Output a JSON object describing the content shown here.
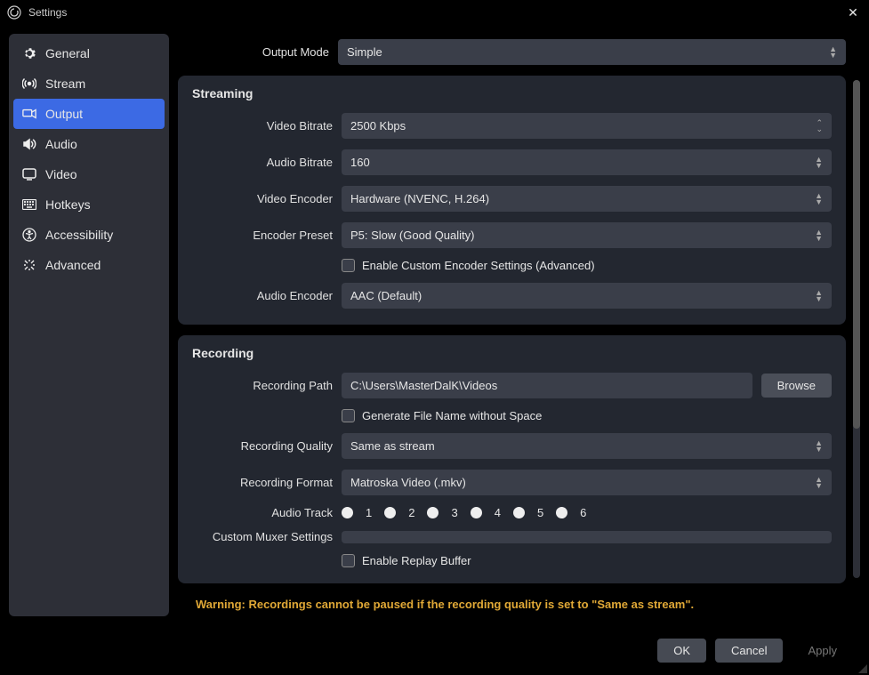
{
  "window": {
    "title": "Settings"
  },
  "sidebar": {
    "items": [
      {
        "label": "General"
      },
      {
        "label": "Stream"
      },
      {
        "label": "Output"
      },
      {
        "label": "Audio"
      },
      {
        "label": "Video"
      },
      {
        "label": "Hotkeys"
      },
      {
        "label": "Accessibility"
      },
      {
        "label": "Advanced"
      }
    ]
  },
  "outputMode": {
    "label": "Output Mode",
    "value": "Simple"
  },
  "streaming": {
    "title": "Streaming",
    "videoBitrate": {
      "label": "Video Bitrate",
      "value": "2500 Kbps"
    },
    "audioBitrate": {
      "label": "Audio Bitrate",
      "value": "160"
    },
    "videoEncoder": {
      "label": "Video Encoder",
      "value": "Hardware (NVENC, H.264)"
    },
    "encoderPreset": {
      "label": "Encoder Preset",
      "value": "P5: Slow (Good Quality)"
    },
    "enableCustom": {
      "label": "Enable Custom Encoder Settings (Advanced)"
    },
    "audioEncoder": {
      "label": "Audio Encoder",
      "value": "AAC (Default)"
    }
  },
  "recording": {
    "title": "Recording",
    "path": {
      "label": "Recording Path",
      "value": "C:\\Users\\MasterDalK\\Videos"
    },
    "browse": "Browse",
    "generateNoSpace": {
      "label": "Generate File Name without Space"
    },
    "quality": {
      "label": "Recording Quality",
      "value": "Same as stream"
    },
    "format": {
      "label": "Recording Format",
      "value": "Matroska Video (.mkv)"
    },
    "audioTrack": {
      "label": "Audio Track",
      "tracks": [
        "1",
        "2",
        "3",
        "4",
        "5",
        "6"
      ]
    },
    "muxer": {
      "label": "Custom Muxer Settings",
      "value": ""
    },
    "replayBuffer": {
      "label": "Enable Replay Buffer"
    }
  },
  "warning": "Warning: Recordings cannot be paused if the recording quality is set to \"Same as stream\".",
  "footer": {
    "ok": "OK",
    "cancel": "Cancel",
    "apply": "Apply"
  }
}
